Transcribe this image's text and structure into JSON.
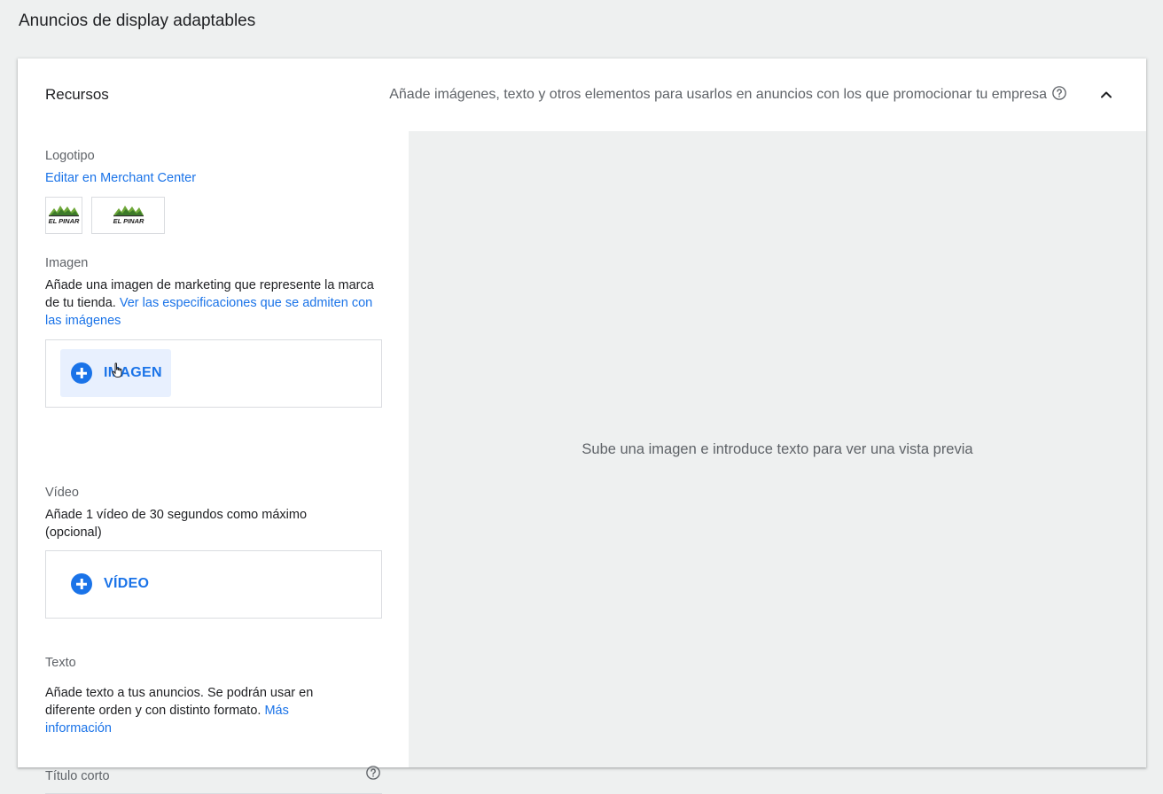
{
  "page": {
    "title": "Anuncios de display adaptables"
  },
  "card": {
    "title": "Recursos",
    "description": "Añade imágenes, texto y otros elementos para usarlos en anuncios con los que promocionar tu empresa",
    "help_icon": "help-circle-icon",
    "collapse_icon": "chevron-up-icon"
  },
  "logo": {
    "label": "Logotipo",
    "link": "Editar en Merchant Center",
    "brand_text": "EL PINAR"
  },
  "image": {
    "label": "Imagen",
    "description": "Añade una imagen de marketing que represente la marca de tu tienda.",
    "link": "Ver las especificaciones que se admiten con las imágenes",
    "button": "IMAGEN"
  },
  "video": {
    "label": "Vídeo",
    "description": "Añade 1 vídeo de 30 segundos como máximo (opcional)",
    "button": "VÍDEO"
  },
  "text": {
    "label": "Texto",
    "description": "Añade texto a tus anuncios. Se podrán usar en diferente orden y con distinto formato.",
    "link": "Más información"
  },
  "short_title": {
    "label": "Título corto",
    "help_icon": "help-circle-icon"
  },
  "preview": {
    "message": "Sube una imagen e introduce texto para ver una vista previa"
  },
  "colors": {
    "accent": "#1a73e8",
    "background": "#eef0f0",
    "text_secondary": "#5f6368"
  }
}
